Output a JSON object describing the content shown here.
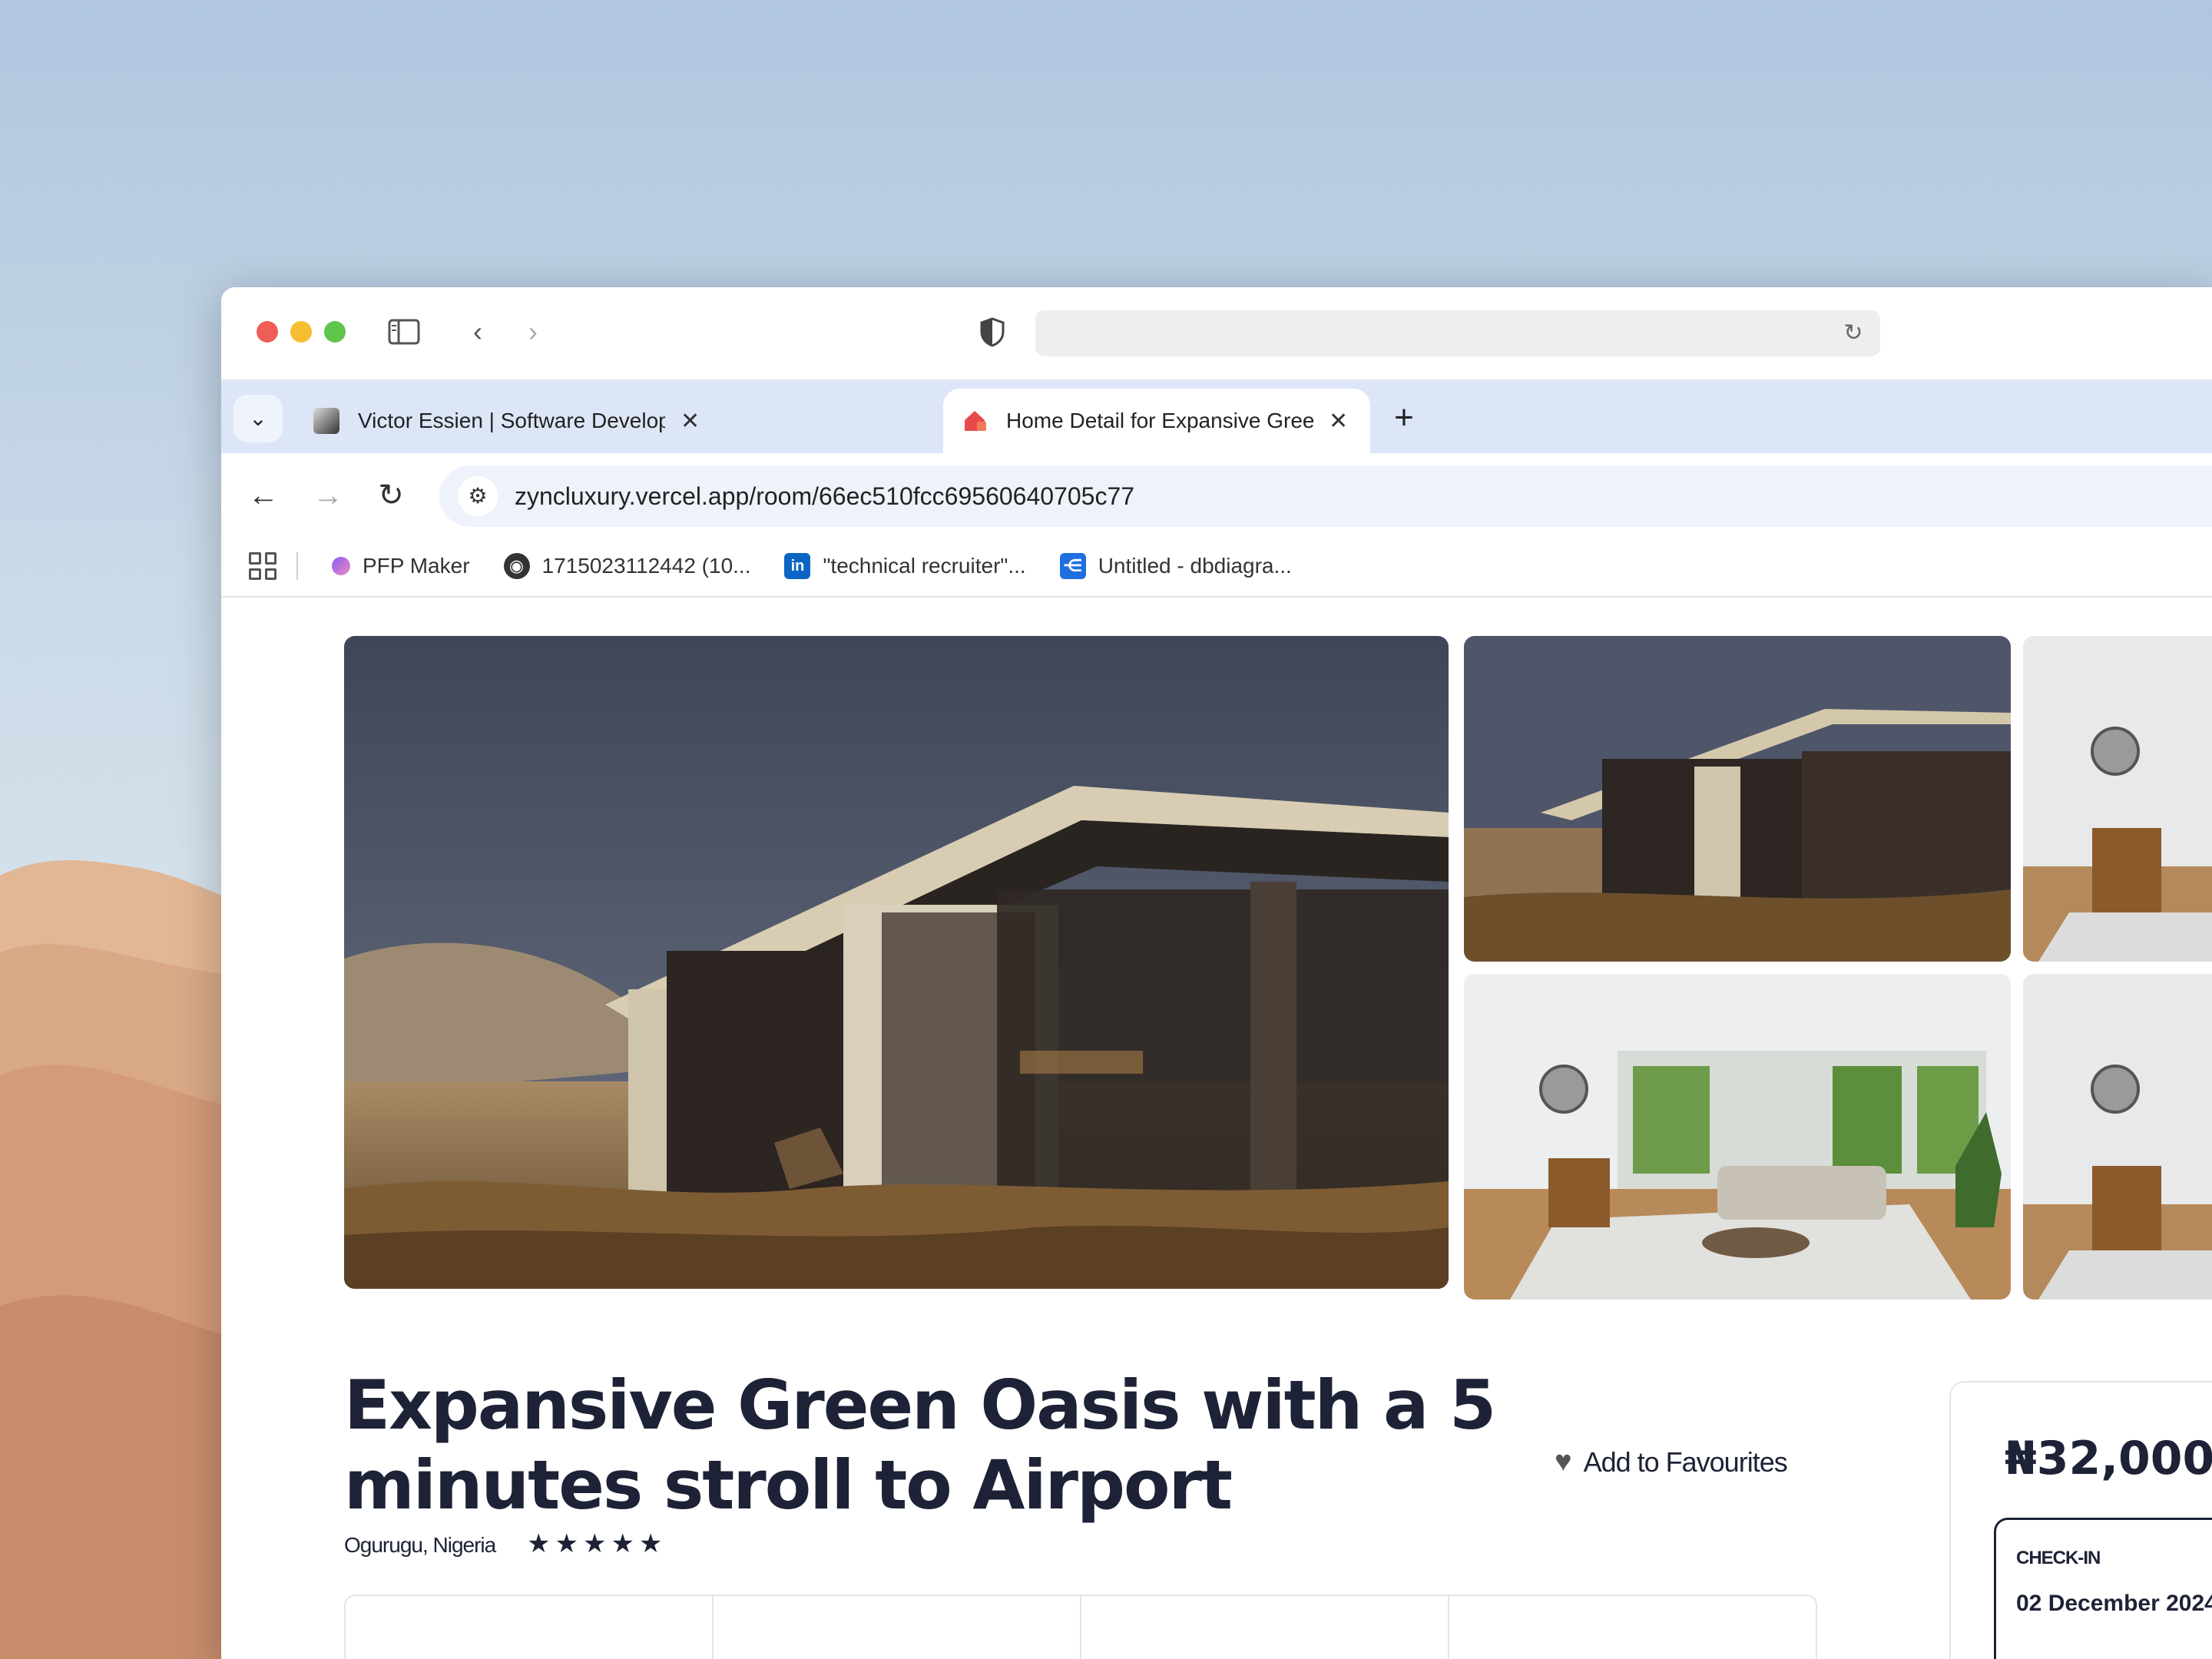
{
  "colors": {
    "accent": "#e84a4a",
    "text_dark": "#1d2236",
    "tab_strip": "#dde6f7"
  },
  "browser": {
    "tabs": [
      {
        "title": "Victor Essien | Software Develop",
        "active": false,
        "favicon": "victor-portrait-icon"
      },
      {
        "title": "Home Detail for Expansive Gree",
        "active": true,
        "favicon": "house-logo-icon"
      }
    ],
    "url": "zyncluxury.vercel.app/room/66ec510fcc69560640705c77",
    "bookmarks": [
      {
        "label": "PFP Maker",
        "icon": "pfp-maker-icon"
      },
      {
        "label": "1715023112442 (10...",
        "icon": "globe-icon"
      },
      {
        "label": "\"technical recruiter\"...",
        "icon": "linkedin-icon"
      },
      {
        "label": "Untitled - dbdiagra...",
        "icon": "dbdiagram-icon"
      }
    ]
  },
  "listing": {
    "title": "Expansive Green Oasis with a 5 minutes stroll to Airport",
    "location": "Ogurugu, Nigeria",
    "rating_stars": 5,
    "stars_text": "★★★★★",
    "favourite_label": "Add to Favourites",
    "price": "₦32,000",
    "checkin_label": "CHECK-IN",
    "checkin_date": "02 December 2024"
  },
  "gallery": {
    "images": [
      "desert-cabin-photo",
      "desert-cabin-photo",
      "living-room-photo",
      "living-room-photo",
      "living-room-photo"
    ]
  }
}
